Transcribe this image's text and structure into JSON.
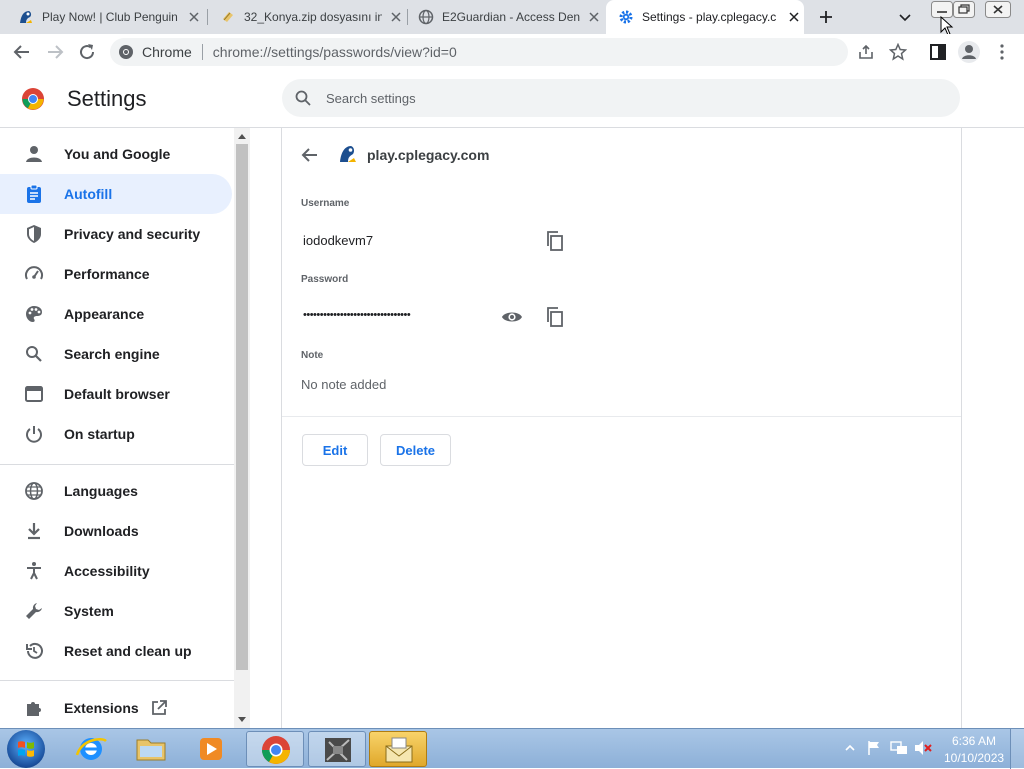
{
  "tabs": [
    {
      "label": "Play Now! | Club Penguin",
      "icon": "penguin-icon"
    },
    {
      "label": "32_Konya.zip dosyasını in",
      "icon": "page-icon"
    },
    {
      "label": "E2Guardian - Access Den",
      "icon": "globe-icon"
    },
    {
      "label": "Settings - play.cplegacy.c",
      "icon": "gear-icon"
    }
  ],
  "omnibox": {
    "site_label": "Chrome",
    "url": "chrome://settings/passwords/view?id=0"
  },
  "settings": {
    "title": "Settings",
    "search_placeholder": "Search settings"
  },
  "sidebar": {
    "items": [
      {
        "label": "You and Google",
        "icon": "person-icon"
      },
      {
        "label": "Autofill",
        "icon": "clipboard-icon",
        "active": true
      },
      {
        "label": "Privacy and security",
        "icon": "shield-icon"
      },
      {
        "label": "Performance",
        "icon": "speedometer-icon"
      },
      {
        "label": "Appearance",
        "icon": "palette-icon"
      },
      {
        "label": "Search engine",
        "icon": "search-icon"
      },
      {
        "label": "Default browser",
        "icon": "browser-icon"
      },
      {
        "label": "On startup",
        "icon": "power-icon"
      },
      {
        "label": "Languages",
        "icon": "globe-icon"
      },
      {
        "label": "Downloads",
        "icon": "download-icon"
      },
      {
        "label": "Accessibility",
        "icon": "accessibility-icon"
      },
      {
        "label": "System",
        "icon": "wrench-icon"
      },
      {
        "label": "Reset and clean up",
        "icon": "history-icon"
      },
      {
        "label": "Extensions",
        "icon": "puzzle-icon"
      }
    ]
  },
  "password_entry": {
    "site": "play.cplegacy.com",
    "username_label": "Username",
    "username": "iododkevm7",
    "password_label": "Password",
    "password_masked": "••••••••••••••••••••••••••••••••",
    "note_label": "Note",
    "note": "No note added",
    "edit_label": "Edit",
    "delete_label": "Delete"
  },
  "taskbar": {
    "time": "6:36 AM",
    "date": "10/10/2023"
  },
  "colors": {
    "accent": "#1a73e8",
    "active_nav_bg": "#e8f0fe",
    "tabstrip": "#dee1e6"
  }
}
